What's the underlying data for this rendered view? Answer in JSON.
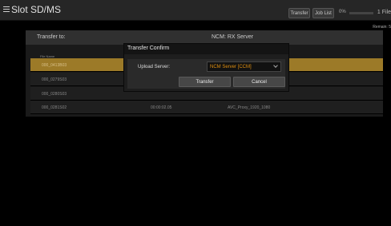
{
  "header": {
    "title": "Slot SD/MS",
    "transfer_button": "Transfer",
    "joblist_button": "Job List",
    "progress_pct": "0%",
    "file_count": "1 File",
    "remain": "Remain: 5"
  },
  "panel": {
    "transfer_to_label": "Transfer to:",
    "server_name": "NCM: RX Server",
    "column_header": "File Name"
  },
  "rows": [
    {
      "clip": "000_0413B03",
      "duration": "",
      "format": "",
      "selected": true
    },
    {
      "clip": "000_0279S03",
      "duration": "",
      "format": ""
    },
    {
      "clip": "000_0280S03",
      "duration": "",
      "format": ""
    },
    {
      "clip": "000_0281S02",
      "duration": "00:00:02.05",
      "format": "AVC_Proxy_1920_1080"
    }
  ],
  "dialog": {
    "title": "Transfer Confirm",
    "upload_label": "Upload Server:",
    "upload_value": "NCM Server [CCM]",
    "transfer_button": "Transfer",
    "cancel_button": "Cancel"
  },
  "colors": {
    "selection": "#9c7a28",
    "server_value": "#e09010"
  }
}
